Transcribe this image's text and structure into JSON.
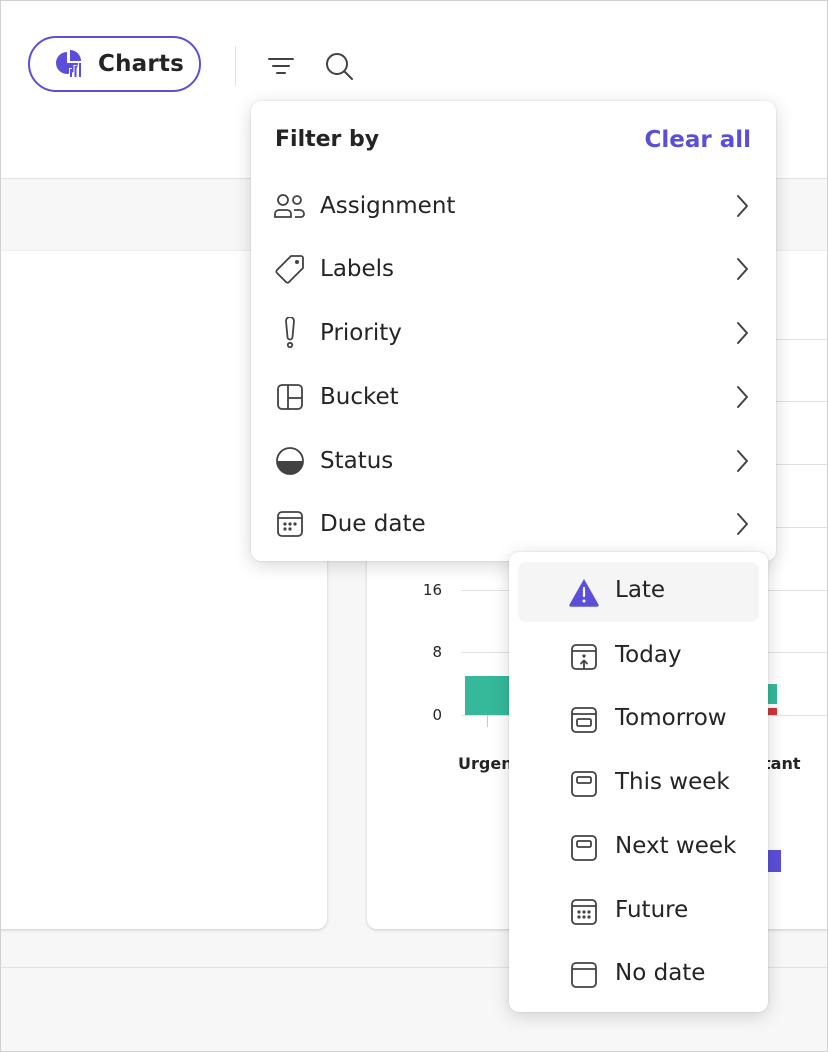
{
  "toolbar": {
    "charts_label": "Charts",
    "filter_icon": "filter-lines-icon",
    "search_icon": "search-icon",
    "accent_color": "#5b4fd9"
  },
  "filter_menu": {
    "title": "Filter by",
    "clear_all": "Clear all",
    "items": [
      {
        "label": "Assignment",
        "icon": "people-icon"
      },
      {
        "label": "Labels",
        "icon": "tag-icon"
      },
      {
        "label": "Priority",
        "icon": "exclamation-icon"
      },
      {
        "label": "Bucket",
        "icon": "board-icon"
      },
      {
        "label": "Status",
        "icon": "half-circle-icon"
      },
      {
        "label": "Due date",
        "icon": "calendar-dots-icon"
      }
    ]
  },
  "due_date_submenu": {
    "items": [
      {
        "label": "Late",
        "icon": "warning-icon",
        "color": "#5b4fd9"
      },
      {
        "label": "Today",
        "icon": "calendar-today-icon"
      },
      {
        "label": "Tomorrow",
        "icon": "calendar-tomorrow-icon"
      },
      {
        "label": "This week",
        "icon": "calendar-week-icon"
      },
      {
        "label": "Next week",
        "icon": "calendar-week-icon"
      },
      {
        "label": "Future",
        "icon": "calendar-future-icon"
      },
      {
        "label": "No date",
        "icon": "calendar-empty-icon"
      }
    ]
  },
  "background_chart": {
    "y_ticks": [
      "16",
      "8",
      "0"
    ],
    "category_left": "Urgen",
    "category_right": "tant",
    "colors": {
      "teal": "#35b99a",
      "red": "#d13438",
      "purple": "#5b4fd9"
    }
  }
}
